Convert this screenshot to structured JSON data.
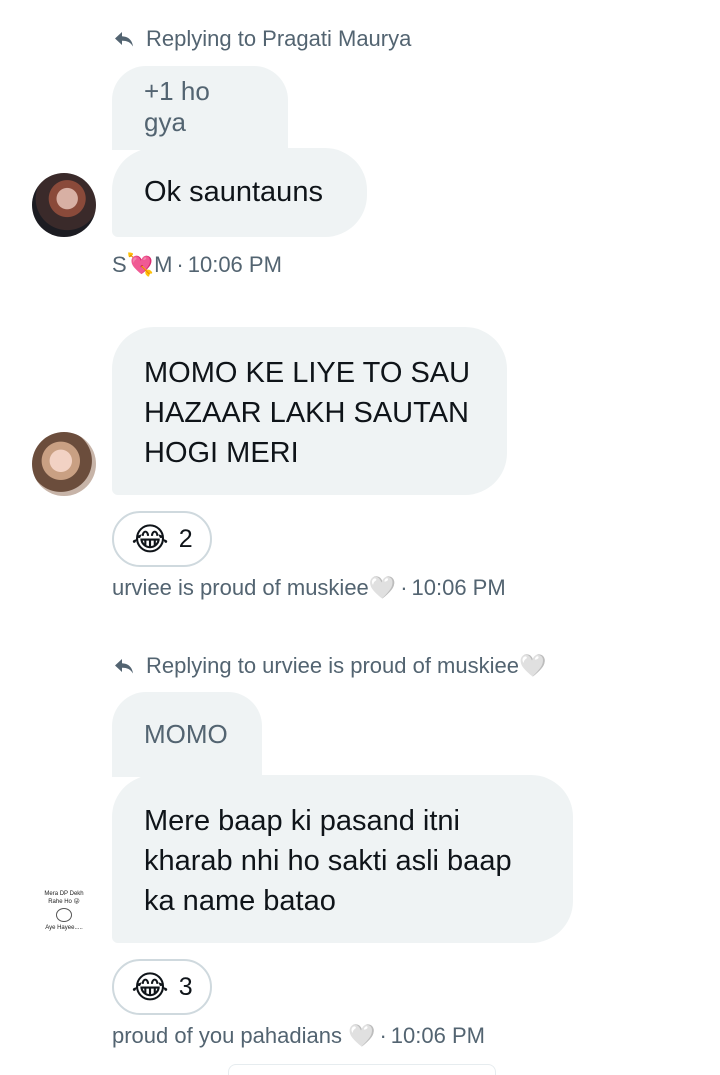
{
  "messages": [
    {
      "reply_label": "Replying to Pragati Maurya",
      "quoted_text": "+1 ho gya",
      "text": "Ok sauntauns",
      "sender": "S💘M",
      "time": "10:06 PM"
    },
    {
      "text_lines": [
        "MOMO KE LIYE TO SAU",
        "HAZAAR LAKH SAUTAN",
        "HOGI MERI"
      ],
      "reaction_emoji": "😂",
      "reaction_count": "2",
      "sender": "urviee is proud of muskiee🤍",
      "time": "10:06 PM"
    },
    {
      "reply_label": "Replying to urviee is proud of muskiee🤍",
      "quoted_text": "MOMO",
      "text_lines": [
        "Mere baap ki pasand itni",
        "kharab nhi ho sakti asli baap",
        "ka name batao"
      ],
      "reaction_emoji": "😂",
      "reaction_count": "3",
      "sender": "proud of you pahadians 🤍",
      "time": "10:06 PM",
      "avatar_text": [
        "Mera DP Dekh",
        "Rahe Ho 😜",
        "Aye Hayee....."
      ]
    }
  ],
  "separator": "·",
  "colors": {
    "bubble": "#eff3f4",
    "secondary_text": "#536471",
    "border": "#cfd9de"
  }
}
